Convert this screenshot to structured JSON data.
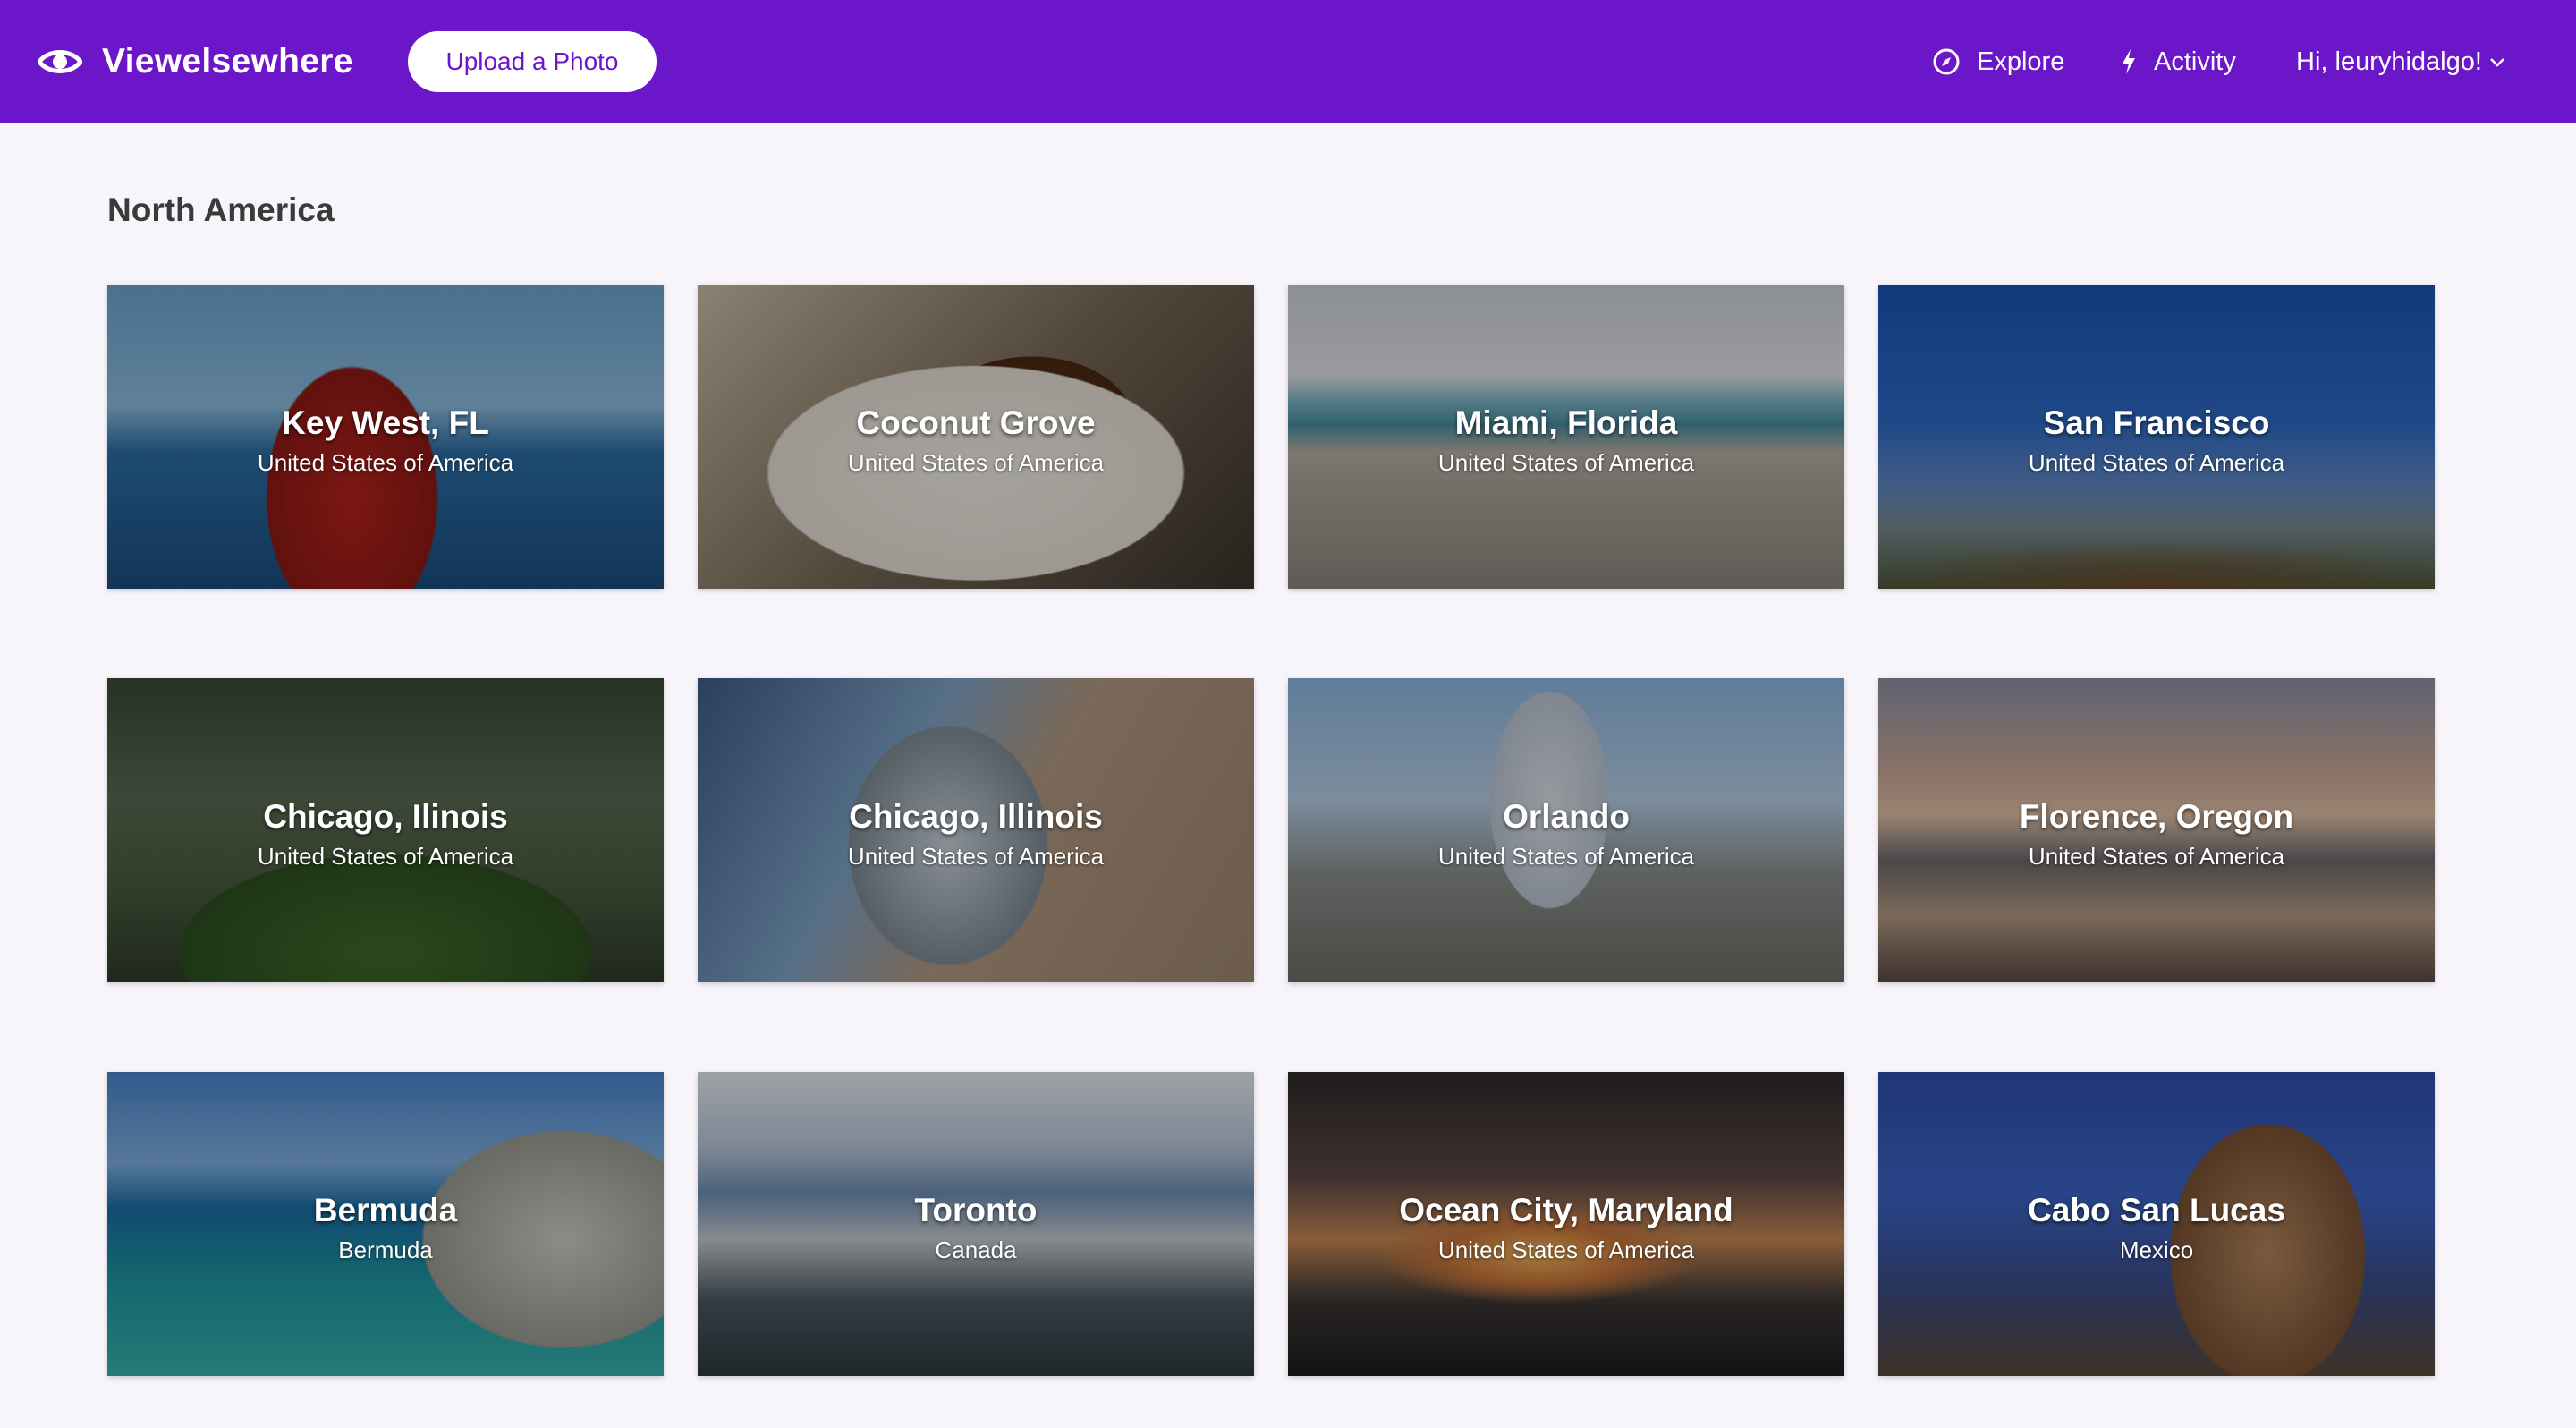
{
  "header": {
    "brand_name": "Viewelsewhere",
    "brand_icon": "eye-icon",
    "upload_label": "Upload a Photo",
    "nav": [
      {
        "label": "Explore",
        "icon": "compass-icon"
      },
      {
        "label": "Activity",
        "icon": "lightning-icon"
      },
      {
        "label": "Hi, leuryhidalgo!",
        "icon": "chevron-down-icon"
      }
    ],
    "colors": {
      "bar": "#6c16c9",
      "button_bg": "#ffffff",
      "button_text": "#6c16c9"
    }
  },
  "section": {
    "title": "North America",
    "places": [
      {
        "city": "Key West, FL",
        "country": "United States of America"
      },
      {
        "city": "Coconut Grove",
        "country": "United States of America"
      },
      {
        "city": "Miami, Florida",
        "country": "United States of America"
      },
      {
        "city": "San Francisco",
        "country": "United States of America"
      },
      {
        "city": "Chicago, Ilinois",
        "country": "United States of America"
      },
      {
        "city": "Chicago, Illinois",
        "country": "United States of America"
      },
      {
        "city": "Orlando",
        "country": "United States of America"
      },
      {
        "city": "Florence, Oregon",
        "country": "United States of America"
      },
      {
        "city": "Bermuda",
        "country": "Bermuda"
      },
      {
        "city": "Toronto",
        "country": "Canada"
      },
      {
        "city": "Ocean City, Maryland",
        "country": "United States of America"
      },
      {
        "city": "Cabo San Lucas",
        "country": "Mexico"
      }
    ]
  }
}
